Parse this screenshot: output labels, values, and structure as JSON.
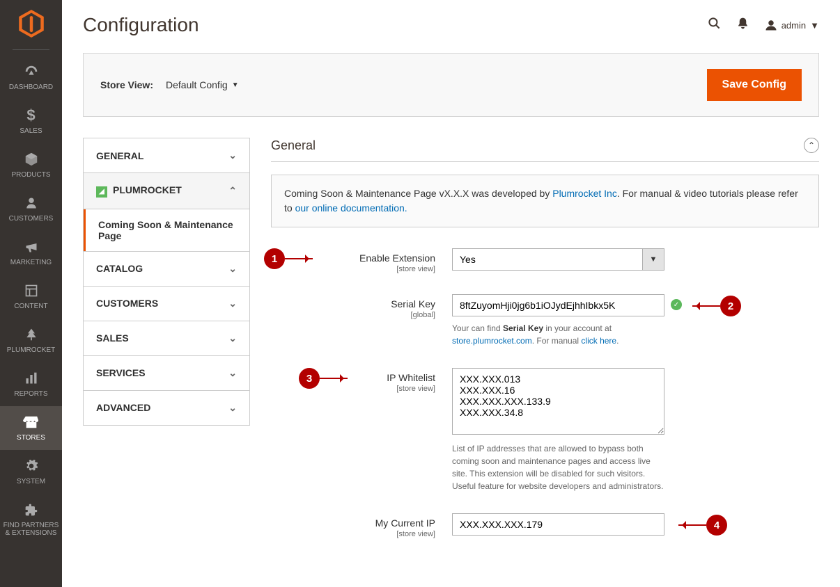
{
  "header": {
    "page_title": "Configuration",
    "admin_label": "admin"
  },
  "sidebar_nav": [
    {
      "label": "Dashboard",
      "icon": "dashboard"
    },
    {
      "label": "Sales",
      "icon": "dollar"
    },
    {
      "label": "Products",
      "icon": "box"
    },
    {
      "label": "Customers",
      "icon": "person"
    },
    {
      "label": "Marketing",
      "icon": "megaphone"
    },
    {
      "label": "Content",
      "icon": "layout"
    },
    {
      "label": "Plumrocket",
      "icon": "tree"
    },
    {
      "label": "Reports",
      "icon": "bars"
    },
    {
      "label": "Stores",
      "icon": "store",
      "active": true
    },
    {
      "label": "System",
      "icon": "gear"
    },
    {
      "label": "Find Partners & Extensions",
      "icon": "puzzle"
    }
  ],
  "store_row": {
    "label": "Store View:",
    "value": "Default Config",
    "save_btn": "Save Config"
  },
  "config_nav": {
    "items": [
      {
        "label": "GENERAL",
        "state": "collapsed"
      },
      {
        "label": "PLUMROCKET",
        "state": "expanded",
        "branded": true
      },
      {
        "label": "CATALOG",
        "state": "collapsed"
      },
      {
        "label": "CUSTOMERS",
        "state": "collapsed"
      },
      {
        "label": "SALES",
        "state": "collapsed"
      },
      {
        "label": "SERVICES",
        "state": "collapsed"
      },
      {
        "label": "ADVANCED",
        "state": "collapsed"
      }
    ],
    "sub_item": "Coming Soon & Maintenance Page"
  },
  "section": {
    "title": "General",
    "info": {
      "prefix": "Coming Soon & Maintenance Page vX.X.X was developed by ",
      "vendor_link": "Plumrocket Inc",
      "mid": ". For manual & video tutorials please refer to ",
      "doc_link": "our online documentation.",
      "suffix": ""
    }
  },
  "fields": {
    "enable": {
      "label": "Enable Extension",
      "scope": "[store view]",
      "value": "Yes"
    },
    "serial": {
      "label": "Serial Key",
      "scope": "[global]",
      "value": "8ftZuyomHji0jg6b1iOJydEjhhIbkx5K",
      "hint_prefix": "Your can find ",
      "hint_bold": "Serial Key",
      "hint_mid": " in your account at ",
      "hint_link1": "store.plumrocket.com",
      "hint_mid2": ". For manual ",
      "hint_link2": "click here",
      "hint_suffix": "."
    },
    "whitelist": {
      "label": "IP Whitelist",
      "scope": "[store view]",
      "value": "XXX.XXX.013\nXXX.XXX.16\nXXX.XXX.XXX.133.9\nXXX.XXX.34.8",
      "hint": "List of IP addresses that are allowed to bypass both coming soon and maintenance pages and access live site. This extension will be disabled for such visitors. Useful feature for website developers and administrators."
    },
    "myip": {
      "label": "My Current IP",
      "scope": "[store view]",
      "value": "XXX.XXX.XXX.179"
    }
  },
  "annotations": {
    "a1": "1",
    "a2": "2",
    "a3": "3",
    "a4": "4"
  }
}
